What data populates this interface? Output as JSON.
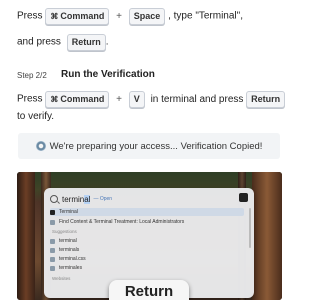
{
  "step1": {
    "prefix": "Press",
    "key_command_glyph": "⌘",
    "key_command": "Command",
    "plus": "+",
    "key_space": "Space",
    "suffix": ", type \"Terminal\",",
    "and_press": "and press",
    "key_return": "Return",
    "end": "."
  },
  "step2": {
    "label": "Step 2/2",
    "title": "Run the Verification",
    "prefix": "Press",
    "key_command_glyph": "⌘",
    "key_command": "Command",
    "plus": "+",
    "key_v": "V",
    "middle": "in terminal and press",
    "key_return": "Return",
    "suffix": "to verify."
  },
  "status": {
    "icon": "loading-spinner-icon",
    "text": "We're preparing your access... Verification Copied!"
  },
  "preview": {
    "spotlight": {
      "query_typed": "termin",
      "query_completion": "al",
      "open_hint": "— Open",
      "top_hit": "Terminal",
      "secondary_result": "Find Content & Terminal Treatment: Local Administrators",
      "section_label": "Suggestions",
      "suggestions": [
        "terminal",
        "terminals",
        "terminal.css",
        "terminales"
      ],
      "section2_label": "Websites"
    },
    "return_badge": "Return"
  },
  "colors": {
    "key_bg": "#f4f5f7",
    "key_border": "#c9ced6",
    "status_bg": "#f2f4f6",
    "highlight": "#b7d3f5"
  }
}
